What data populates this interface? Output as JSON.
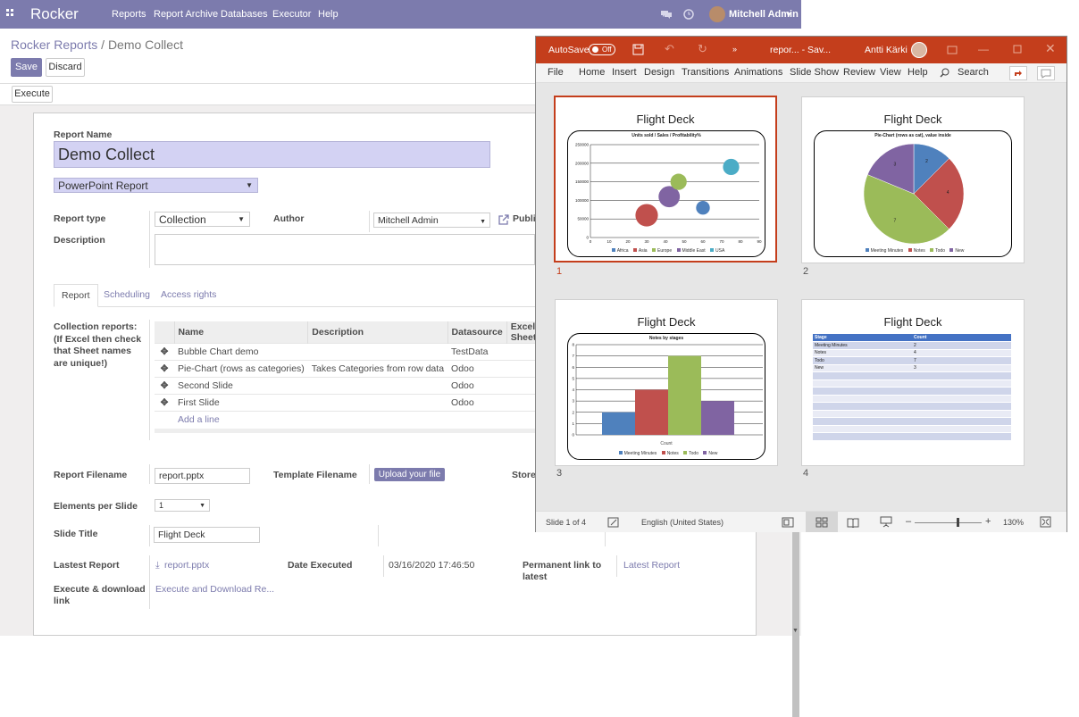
{
  "navbar": {
    "brand": "Rocker",
    "menu": [
      "Reports",
      "Report Archive",
      "Databases",
      "Executor",
      "Help"
    ],
    "user": "Mitchell Admin"
  },
  "breadcrumb": {
    "parent": "Rocker Reports",
    "separator": "/",
    "current": "Demo Collect"
  },
  "buttons": {
    "save": "Save",
    "discard": "Discard",
    "execute": "Execute",
    "upload": "Upload your file"
  },
  "form": {
    "report_name_label": "Report Name",
    "report_name": "Demo Collect",
    "output_type": "PowerPoint Report",
    "report_type_label": "Report type",
    "report_type": "Collection",
    "author_label": "Author",
    "author": "Mitchell Admin",
    "publish_label": "Publis",
    "description_label": "Description",
    "collection_label": "Collection reports: (If Excel then check that Sheet names are unique!)",
    "filename_label": "Report Filename",
    "filename": "report.pptx",
    "template_label": "Template Filename",
    "store_label": "Store t",
    "elements_label": "Elements per Slide",
    "elements": "1",
    "slide_title_label": "Slide Title",
    "slide_title": "Flight Deck",
    "latest_label": "Lastest Report",
    "latest_file": "report.pptx",
    "date_label": "Date Executed",
    "date": "03/16/2020 17:46:50",
    "perm_label": "Permanent link to latest",
    "perm_link": "Latest Report",
    "exec_label": "Execute & download link",
    "exec_link": "Execute and Download Re..."
  },
  "tabs": [
    "Report",
    "Scheduling",
    "Access rights"
  ],
  "grid": {
    "headers": [
      "Name",
      "Description",
      "Datasource",
      "Excel Sheet"
    ],
    "rows": [
      {
        "name": "Bubble Chart demo",
        "desc": "",
        "ds": "TestData"
      },
      {
        "name": "Pie-Chart (rows as categories)",
        "desc": "Takes Categories from row data",
        "ds": "Odoo"
      },
      {
        "name": "Second Slide",
        "desc": "",
        "ds": "Odoo"
      },
      {
        "name": "First Slide",
        "desc": "",
        "ds": "Odoo"
      }
    ],
    "add_line": "Add a line"
  },
  "ppt": {
    "autosave": "AutoSave",
    "autosave_state": "Off",
    "doc": "repor... - Sav...",
    "user": "Antti Kärki",
    "ribbon": [
      "File",
      "Home",
      "Insert",
      "Design",
      "Transitions",
      "Animations",
      "Slide Show",
      "Review",
      "View",
      "Help",
      "Search"
    ],
    "slide_title": "Flight Deck",
    "slide_numbers": [
      "1",
      "2",
      "3",
      "4"
    ],
    "status_slide": "Slide 1 of 4",
    "language": "English (United States)",
    "zoom": "130%"
  },
  "chart_data": [
    {
      "type": "scatter",
      "title": "Units sold / Sales / Profitability%",
      "series": [
        {
          "name": "Africa",
          "x": 30,
          "y": 60000,
          "size": 0.9,
          "color": "#c0504d"
        },
        {
          "name": "Asia",
          "x": 42,
          "y": 110000,
          "size": 0.85,
          "color": "#8064a2"
        },
        {
          "name": "Europe",
          "x": 47,
          "y": 150000,
          "size": 0.65,
          "color": "#9bbb59"
        },
        {
          "name": "Middle East",
          "x": 60,
          "y": 80000,
          "size": 0.55,
          "color": "#4f81bd"
        },
        {
          "name": "USA",
          "x": 75,
          "y": 190000,
          "size": 0.65,
          "color": "#4bacc6"
        }
      ],
      "xlim": [
        0,
        90
      ],
      "ylim": [
        0,
        250000
      ],
      "xticks": [
        "0",
        "10",
        "20",
        "30",
        "40",
        "50",
        "60",
        "70",
        "80",
        "90"
      ],
      "yticks": [
        "0",
        "50000",
        "100000",
        "150000",
        "200000",
        "250000"
      ],
      "legend": [
        "Africa",
        "Asia",
        "Europe",
        "Middle East",
        "USA"
      ]
    },
    {
      "type": "pie",
      "title": "Pie-Chart (rows as cat), value inside",
      "categories": [
        "Meeting Minutes",
        "Notes",
        "Todo",
        "New"
      ],
      "values": [
        2,
        4,
        7,
        3
      ],
      "colors": [
        "#4f81bd",
        "#c0504d",
        "#9bbb59",
        "#8064a2"
      ]
    },
    {
      "type": "bar",
      "title": "Notes by stages",
      "categories": [
        "Meeting Minutes",
        "Notes",
        "Todo",
        "New"
      ],
      "values": [
        2,
        4,
        7,
        3
      ],
      "colors": [
        "#4f81bd",
        "#c0504d",
        "#9bbb59",
        "#8064a2"
      ],
      "ylim": [
        0,
        8
      ],
      "yticks": [
        "0",
        "1",
        "2",
        "3",
        "4",
        "5",
        "6",
        "7",
        "8"
      ],
      "xlabel": "Count"
    },
    {
      "type": "table",
      "columns": [
        "Stage",
        "Count"
      ],
      "rows": [
        [
          "Meeting Minutes",
          "2"
        ],
        [
          "Notes",
          "4"
        ],
        [
          "Todo",
          "7"
        ],
        [
          "New",
          "3"
        ]
      ]
    }
  ]
}
